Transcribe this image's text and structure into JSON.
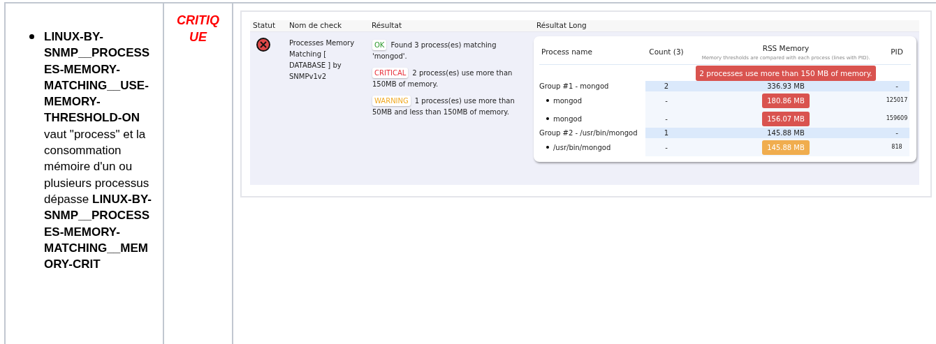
{
  "description": "**LINUX-BY-SNMP__PROCESSES-MEMORY-MATCHING__USE-MEMORY-THRESHOLD-ON** vaut \"process\" et la consommation mémoire d'un ou plusieurs processus dépasse **LINUX-BY-SNMP__PROCESSES-MEMORY-MATCHING__MEMORY-CRIT**",
  "severity": "CRITIQUE",
  "check_table": {
    "columns": [
      "Statut",
      "Nom de check",
      "Résultat",
      "Résultat Long"
    ],
    "row": {
      "kind": "critical",
      "check_name": "Processes Memory Matching [ DATABASE ] by SNMPv1v2",
      "results": [
        {
          "kind": "ok",
          "badge": "OK",
          "text": "Found 3 process(es) matching 'mongod'."
        },
        {
          "kind": "critical",
          "badge": "CRITICAL",
          "text": "2 process(es) use more than 150MB of memory."
        },
        {
          "kind": "warning",
          "badge": "WARNING",
          "text": "1 process(es) use more than 50MB and less than 150MB of memory."
        }
      ],
      "long_result": {
        "columns": [
          "Process name",
          "Count (3)",
          "RSS Memory",
          "PID"
        ],
        "memory_note": "Memory thresholds are compared with each process (lines with PID).",
        "alert": "2 processes use more than 150 MB of memory.",
        "rows": [
          {
            "kind": "group",
            "name": "Group #1 - mongod",
            "count": "2",
            "memory": "336.93 MB",
            "pid": "-"
          },
          {
            "kind": "process",
            "name": "mongod",
            "count": "-",
            "memory": "180.86 MB",
            "color": "#d9534f",
            "pid": "125017"
          },
          {
            "kind": "process",
            "name": "mongod",
            "count": "-",
            "memory": "156.07 MB",
            "color": "#d9534f",
            "pid": "159609"
          },
          {
            "kind": "group",
            "name": "Group #2 - /usr/bin/mongod",
            "count": "1",
            "memory": "145.88 MB",
            "pid": "-"
          },
          {
            "kind": "process",
            "name": "/usr/bin/mongod",
            "count": "-",
            "memory": "145.88 MB",
            "color": "#f0ad4e",
            "pid": "818"
          }
        ]
      }
    }
  }
}
